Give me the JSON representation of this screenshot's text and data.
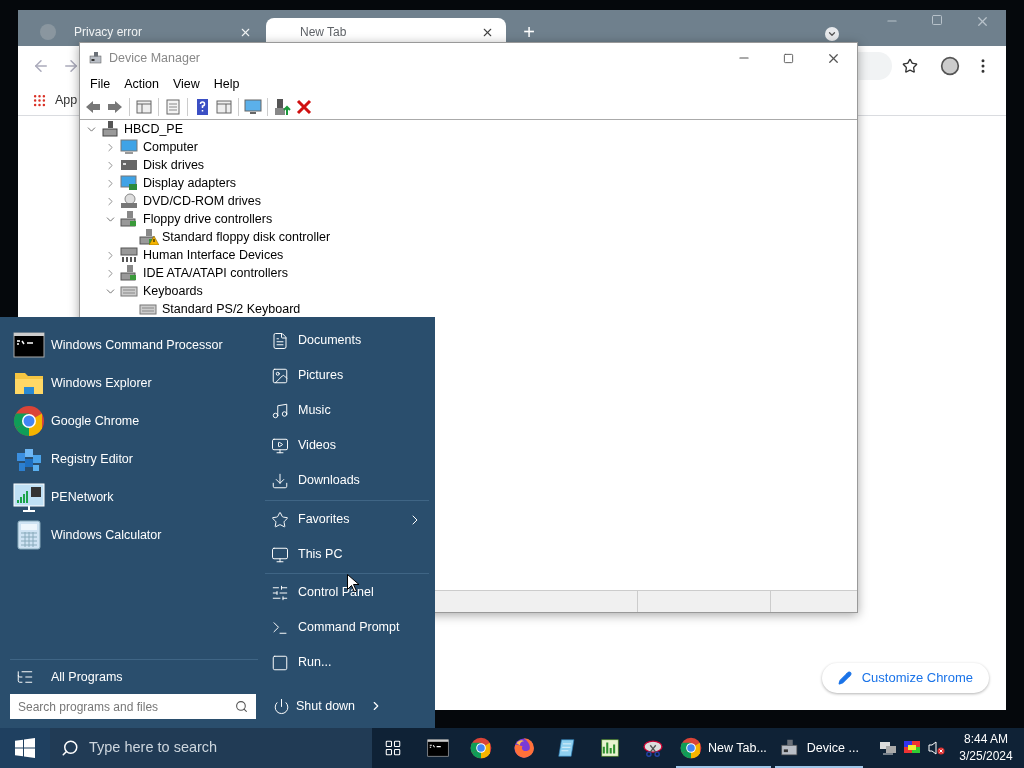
{
  "chrome": {
    "tabs": [
      {
        "title": "Privacy error",
        "selected": false
      },
      {
        "title": "New Tab",
        "selected": true
      }
    ],
    "new_tab": "+",
    "bookmarks": [
      {
        "label": "App"
      }
    ],
    "customize_button": "Customize Chrome"
  },
  "device_manager": {
    "title": "Device Manager",
    "menu": [
      "File",
      "Action",
      "View",
      "Help"
    ],
    "tree": {
      "label": "HBCD_PE",
      "kind": "computer",
      "expanded": true,
      "children": [
        {
          "label": "Computer",
          "kind": "monitor",
          "expanded": false
        },
        {
          "label": "Disk drives",
          "kind": "disk",
          "expanded": false
        },
        {
          "label": "Display adapters",
          "kind": "display",
          "expanded": false
        },
        {
          "label": "DVD/CD-ROM drives",
          "kind": "dvd",
          "expanded": false
        },
        {
          "label": "Floppy drive controllers",
          "kind": "controller",
          "expanded": true,
          "children": [
            {
              "label": "Standard floppy disk controller",
              "kind": "controller",
              "warning": true
            }
          ]
        },
        {
          "label": "Human Interface Devices",
          "kind": "hid",
          "expanded": false
        },
        {
          "label": "IDE ATA/ATAPI controllers",
          "kind": "controller",
          "expanded": false
        },
        {
          "label": "Keyboards",
          "kind": "keyboard",
          "expanded": true,
          "children": [
            {
              "label": "Standard PS/2 Keyboard",
              "kind": "keyboard",
              "warning": false
            }
          ]
        }
      ]
    }
  },
  "start_menu": {
    "programs": [
      {
        "name": "Windows Command Processor",
        "kind": "cmd"
      },
      {
        "name": "Windows Explorer",
        "kind": "folder"
      },
      {
        "name": "Google Chrome",
        "kind": "chrome"
      },
      {
        "name": "Registry Editor",
        "kind": "registry"
      },
      {
        "name": "PENetwork",
        "kind": "network"
      },
      {
        "name": "Windows Calculator",
        "kind": "calculator"
      }
    ],
    "all_programs": "All Programs",
    "search": {
      "placeholder": "Search programs and files"
    },
    "place_groups": [
      [
        {
          "label": "Documents",
          "kind": "document",
          "submenu": false
        },
        {
          "label": "Pictures",
          "kind": "picture",
          "submenu": false
        },
        {
          "label": "Music",
          "kind": "music",
          "submenu": false
        },
        {
          "label": "Videos",
          "kind": "video",
          "submenu": false
        },
        {
          "label": "Downloads",
          "kind": "download",
          "submenu": false
        }
      ],
      [
        {
          "label": "Favorites",
          "kind": "star",
          "submenu": true
        },
        {
          "label": "This PC",
          "kind": "pc",
          "submenu": false
        }
      ],
      [
        {
          "label": "Control Panel",
          "kind": "panel",
          "submenu": false
        },
        {
          "label": "Command Prompt",
          "kind": "prompt",
          "submenu": false
        },
        {
          "label": "Run...",
          "kind": "run",
          "submenu": false
        }
      ]
    ],
    "shut_down": "Shut down"
  },
  "taskbar": {
    "search": {
      "placeholder": "Type here to search"
    },
    "apps": [
      {
        "kind": "cmd",
        "running": false
      },
      {
        "kind": "chrome",
        "running": false
      },
      {
        "kind": "firefox",
        "running": false
      },
      {
        "kind": "notes",
        "running": false
      },
      {
        "kind": "chart",
        "running": false
      },
      {
        "kind": "snip",
        "running": false
      },
      {
        "kind": "chrome",
        "label": "New Tab...",
        "running": true
      },
      {
        "kind": "device",
        "label": "Device ...",
        "running": true
      }
    ],
    "clock": {
      "time": "8:44 AM",
      "date": "3/25/2024"
    }
  }
}
